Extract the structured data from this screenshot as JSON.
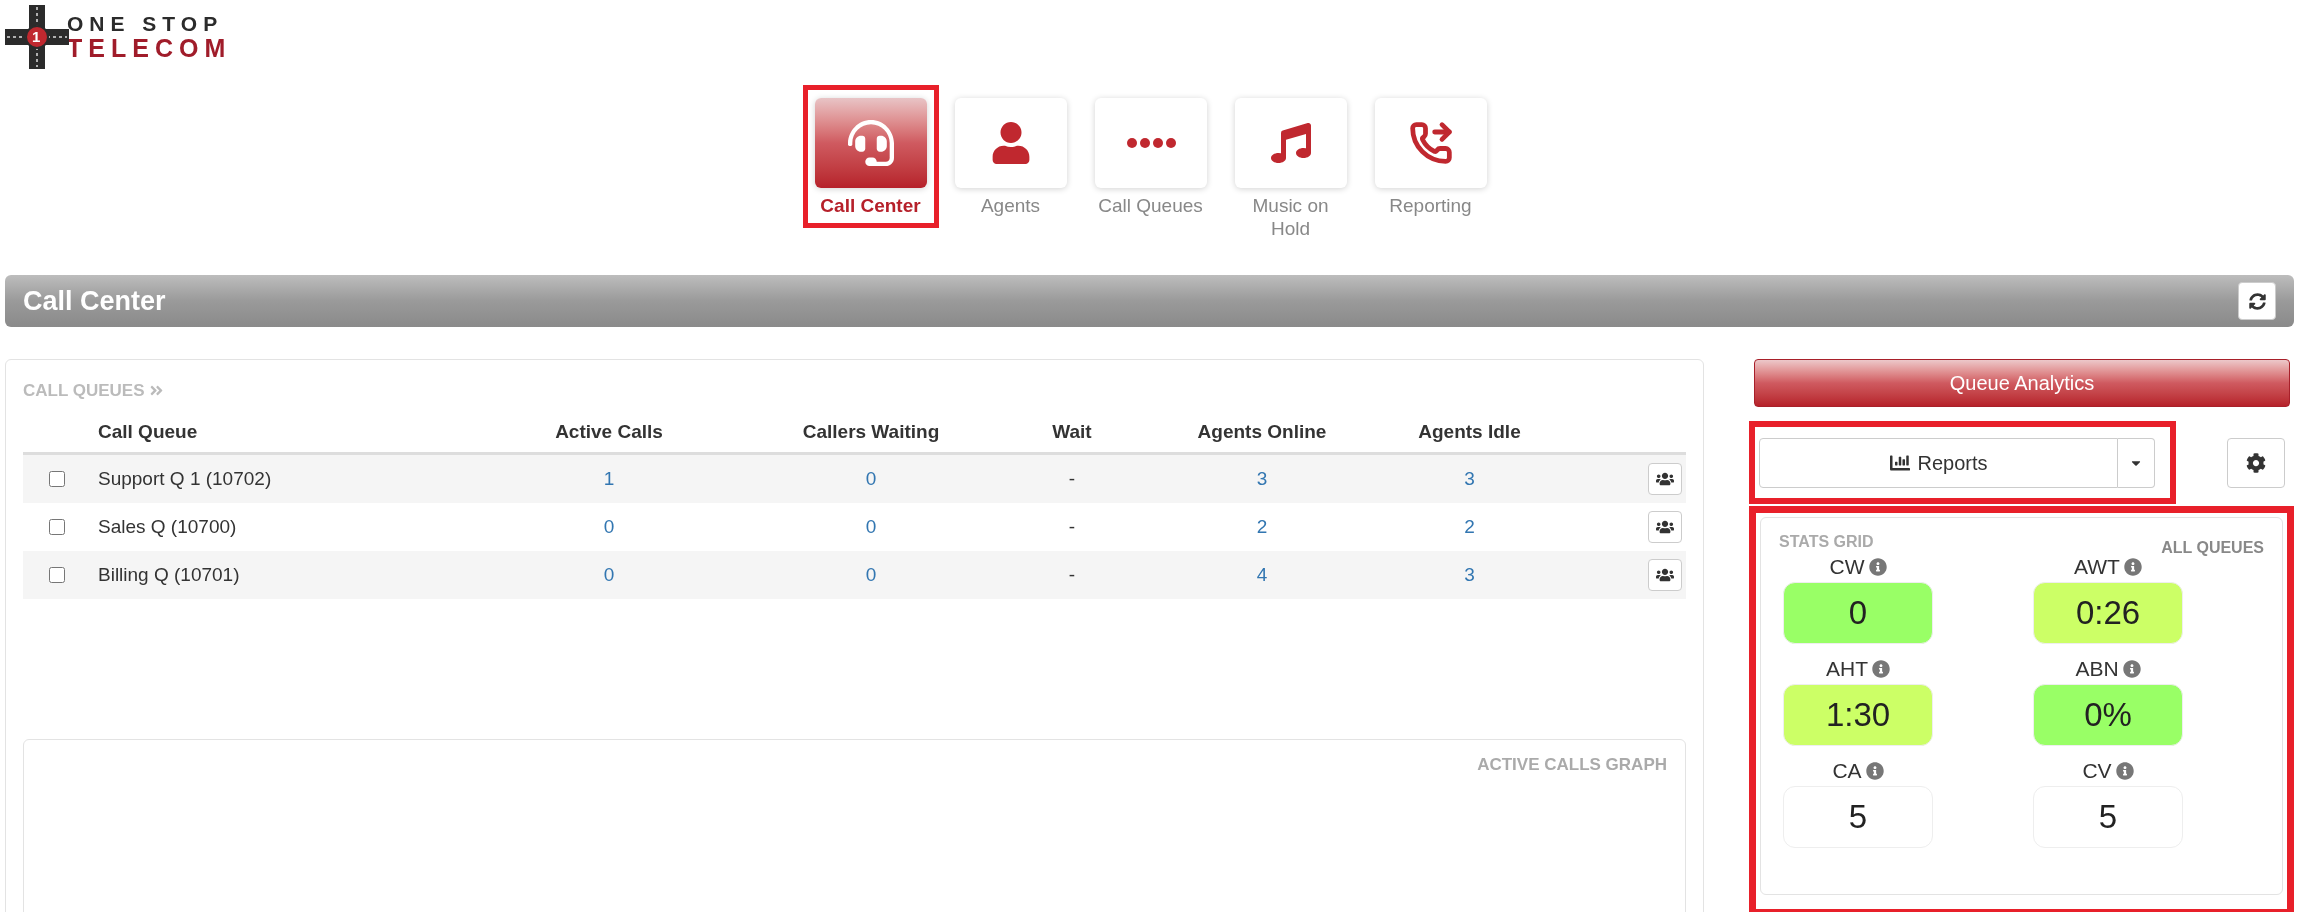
{
  "logo": {
    "badge": "1",
    "line_1": "ONE STOP",
    "line_2": "TELECOM"
  },
  "nav": [
    {
      "label": "Call Center",
      "kind": "headset",
      "selected": true,
      "highlighted": true
    },
    {
      "label": "Agents",
      "kind": "user",
      "selected": false,
      "highlighted": false
    },
    {
      "label": "Call Queues",
      "kind": "dots",
      "selected": false,
      "highlighted": false
    },
    {
      "label": "Music on Hold",
      "kind": "music",
      "selected": false,
      "highlighted": false
    },
    {
      "label": "Reporting",
      "kind": "phone",
      "selected": false,
      "highlighted": false
    }
  ],
  "header": {
    "title": "Call Center"
  },
  "call_queues": {
    "title": "CALL QUEUES",
    "columns": [
      "Call Queue",
      "Active Calls",
      "Callers Waiting",
      "Wait",
      "Agents Online",
      "Agents Idle"
    ],
    "rows": [
      {
        "checked": false,
        "name": "Support Q 1 (10702)",
        "active_calls": "1",
        "callers_waiting": "0",
        "wait": "-",
        "agents_online": "3",
        "agents_idle": "3"
      },
      {
        "checked": false,
        "name": "Sales Q (10700)",
        "active_calls": "0",
        "callers_waiting": "0",
        "wait": "-",
        "agents_online": "2",
        "agents_idle": "2"
      },
      {
        "checked": false,
        "name": "Billing Q (10701)",
        "active_calls": "0",
        "callers_waiting": "0",
        "wait": "-",
        "agents_online": "4",
        "agents_idle": "3"
      }
    ]
  },
  "graph": {
    "title": "ACTIVE CALLS GRAPH"
  },
  "queue_analytics_button": "Queue Analytics",
  "reports": {
    "label": "Reports",
    "highlighted": true
  },
  "stats": {
    "title": "STATS GRID",
    "scope": "ALL QUEUES",
    "highlighted": true,
    "items": [
      {
        "label": "CW",
        "value": "0",
        "color": "#99ff66"
      },
      {
        "label": "AWT",
        "value": "0:26",
        "color": "#ccff66"
      },
      {
        "label": "AHT",
        "value": "1:30",
        "color": "#ccff66"
      },
      {
        "label": "ABN",
        "value": "0%",
        "color": "#99ff66"
      },
      {
        "label": "CA",
        "value": "5",
        "color": "#ffffff"
      },
      {
        "label": "CV",
        "value": "5",
        "color": "#ffffff"
      }
    ]
  }
}
